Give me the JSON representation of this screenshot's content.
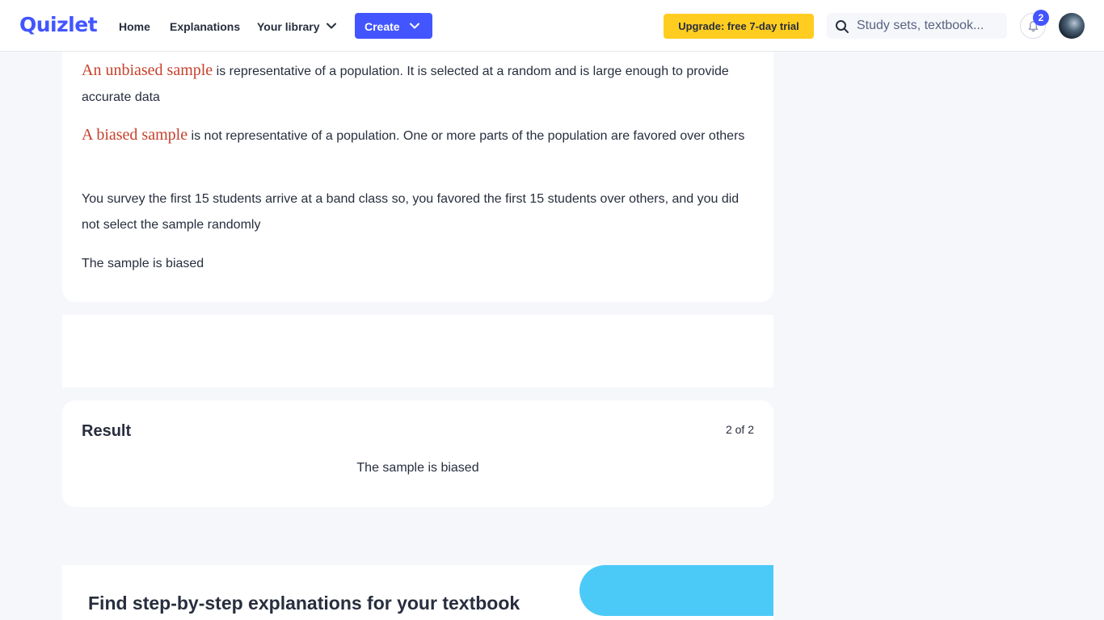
{
  "header": {
    "logo": "Quizlet",
    "nav": {
      "home": "Home",
      "explanations": "Explanations",
      "your_library": "Your library"
    },
    "create_label": "Create",
    "upgrade_label": "Upgrade: free 7-day trial",
    "search_placeholder": "Study sets, textbook...",
    "notification_count": "2",
    "accent_color": "#4255ff",
    "upgrade_color": "#ffcd1f"
  },
  "step": {
    "p1_term": "An unbiased sample",
    "p1_text": " is representative of a population. It is selected at a random and is large enough to provide accurate data",
    "p2_term": "A biased sample",
    "p2_text": " is not representative of a population. One or more parts of the population are favored over others",
    "p3_text": "You survey the first 15 students arrive at a band class so, you favored the first 15 students over others, and you did not select the sample randomly",
    "p4_text": "The sample is biased",
    "term_color": "#c6412c"
  },
  "result": {
    "title": "Result",
    "count": "2 of 2",
    "text": "The sample is biased"
  },
  "promo": {
    "title": "Find step-by-step explanations for your textbook",
    "blob_color": "#4ccaf7"
  }
}
